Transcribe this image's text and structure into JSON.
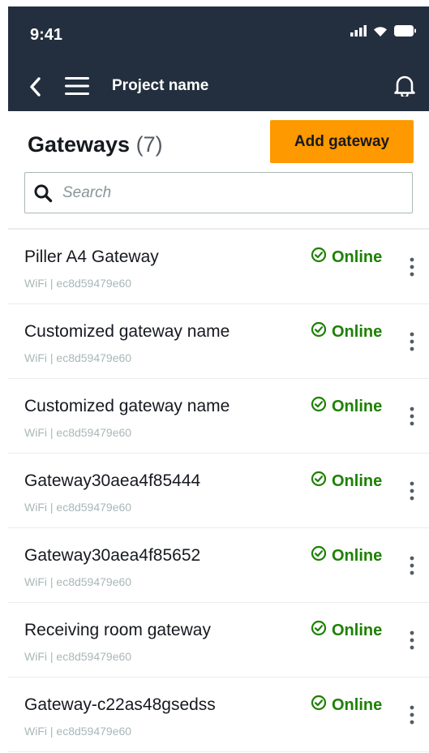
{
  "status_bar": {
    "time": "9:41",
    "icons": [
      "signal-icon",
      "wifi-icon",
      "battery-icon"
    ]
  },
  "nav": {
    "title": "Project name",
    "icons": [
      "back-icon",
      "menu-icon",
      "bell-icon"
    ]
  },
  "header": {
    "title": "Gateways",
    "count": "(7)",
    "add_button": "Add gateway"
  },
  "search": {
    "placeholder": "Search",
    "value": ""
  },
  "colors": {
    "topbar": "#232f3e",
    "accent": "#ff9900",
    "online": "#1d8102",
    "meta": "#aab7b8"
  },
  "gateways": [
    {
      "name": "Piller A4 Gateway",
      "meta": "WiFi | ec8d59479e60",
      "status": "Online"
    },
    {
      "name": "Customized gateway name",
      "meta": "WiFi | ec8d59479e60",
      "status": "Online"
    },
    {
      "name": "Customized gateway name",
      "meta": "WiFi | ec8d59479e60",
      "status": "Online"
    },
    {
      "name": "Gateway30aea4f85444",
      "meta": "WiFi | ec8d59479e60",
      "status": "Online"
    },
    {
      "name": "Gateway30aea4f85652",
      "meta": "WiFi | ec8d59479e60",
      "status": "Online"
    },
    {
      "name": "Receiving room gateway",
      "meta": "WiFi | ec8d59479e60",
      "status": "Online"
    },
    {
      "name": "Gateway-c22as48gsedss",
      "meta": "WiFi | ec8d59479e60",
      "status": "Online"
    }
  ]
}
